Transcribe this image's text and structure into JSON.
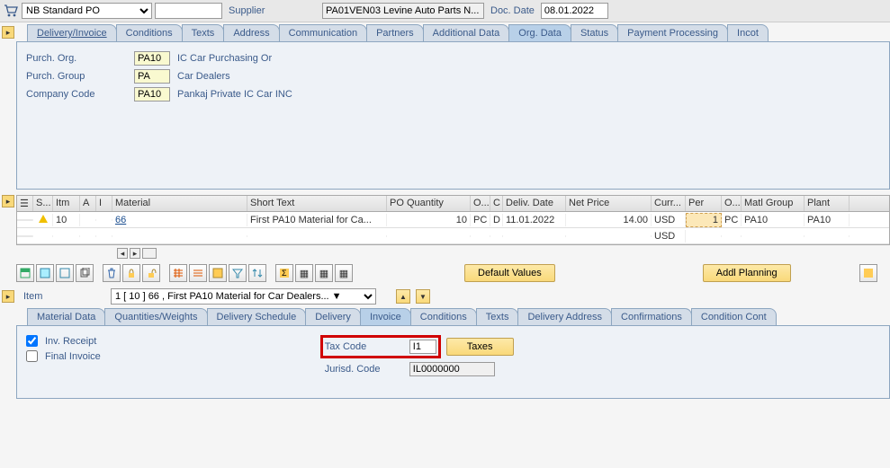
{
  "header": {
    "po_type": "NB Standard PO",
    "po_number": "",
    "supplier_label": "Supplier",
    "supplier_value": "PA01VEN03 Levine Auto Parts N...",
    "doc_date_label": "Doc. Date",
    "doc_date_value": "08.01.2022"
  },
  "header_tabs": {
    "items": [
      {
        "label": "Delivery/Invoice"
      },
      {
        "label": "Conditions"
      },
      {
        "label": "Texts"
      },
      {
        "label": "Address"
      },
      {
        "label": "Communication"
      },
      {
        "label": "Partners"
      },
      {
        "label": "Additional Data"
      },
      {
        "label": "Org. Data"
      },
      {
        "label": "Status"
      },
      {
        "label": "Payment Processing"
      },
      {
        "label": "Incot"
      }
    ],
    "active_index": 7
  },
  "org_data": {
    "purch_org_label": "Purch. Org.",
    "purch_org_value": "PA10",
    "purch_org_desc": "IC Car Purchasing Or",
    "purch_group_label": "Purch. Group",
    "purch_group_value": "PA",
    "purch_group_desc": "Car Dealers",
    "company_code_label": "Company Code",
    "company_code_value": "PA10",
    "company_code_desc": "Pankaj Private IC Car INC"
  },
  "grid": {
    "columns": [
      "S...",
      "Itm",
      "A",
      "I",
      "Material",
      "Short Text",
      "PO Quantity",
      "O...",
      "C",
      "Deliv. Date",
      "Net Price",
      "Curr...",
      "Per",
      "O...",
      "Matl Group",
      "Plant"
    ],
    "rows": [
      {
        "s": "warn",
        "itm": "10",
        "a": "",
        "i": "",
        "material": "66",
        "short_text": "First PA10 Material for Ca...",
        "qty": "10",
        "ounit": "PC",
        "c": "D",
        "deliv_date": "11.01.2022",
        "net_price": "14.00",
        "curr": "USD",
        "per": "1",
        "ounit2": "PC",
        "matl_group": "PA10",
        "plant": "PA10"
      },
      {
        "s": "",
        "itm": "",
        "a": "",
        "i": "",
        "material": "",
        "short_text": "",
        "qty": "",
        "ounit": "",
        "c": "",
        "deliv_date": "",
        "net_price": "",
        "curr": "USD",
        "per": "",
        "ounit2": "",
        "matl_group": "",
        "plant": ""
      }
    ]
  },
  "buttons": {
    "default_values": "Default Values",
    "addl_planning": "Addl Planning"
  },
  "item_detail": {
    "item_label": "Item",
    "item_selector": "1 [ 10 ] 66 , First PA10 Material for Car Dealers... ▼"
  },
  "detail_tabs": {
    "items": [
      {
        "label": "Material Data"
      },
      {
        "label": "Quantities/Weights"
      },
      {
        "label": "Delivery Schedule"
      },
      {
        "label": "Delivery"
      },
      {
        "label": "Invoice"
      },
      {
        "label": "Conditions"
      },
      {
        "label": "Texts"
      },
      {
        "label": "Delivery Address"
      },
      {
        "label": "Confirmations"
      },
      {
        "label": "Condition Cont"
      }
    ],
    "active_index": 4
  },
  "invoice_tab": {
    "inv_receipt_label": "Inv. Receipt",
    "inv_receipt_checked": true,
    "final_invoice_label": "Final Invoice",
    "final_invoice_checked": false,
    "tax_code_label": "Tax Code",
    "tax_code_value": "I1",
    "taxes_button": "Taxes",
    "jurisd_code_label": "Jurisd. Code",
    "jurisd_code_value": "IL0000000"
  }
}
